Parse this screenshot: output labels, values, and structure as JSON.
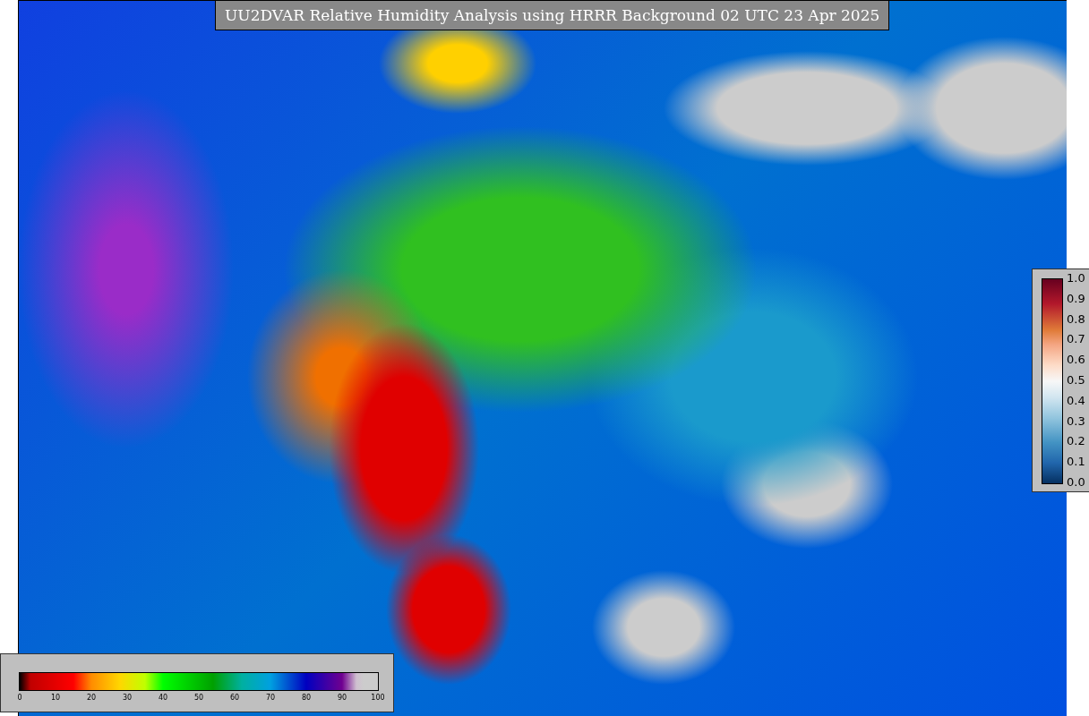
{
  "title": "UU2DVAR Relative Humidity Analysis using HRRR Background 02 UTC 23 Apr 2025",
  "humidity_legend": {
    "ticks": [
      "0",
      "10",
      "20",
      "30",
      "40",
      "50",
      "60",
      "70",
      "80",
      "90",
      "100"
    ]
  },
  "observation_legend": {
    "ticks": [
      "1.0",
      "0.9",
      "0.8",
      "0.7",
      "0.6",
      "0.5",
      "0.4",
      "0.3",
      "0.2",
      "0.1",
      "0.0"
    ]
  }
}
